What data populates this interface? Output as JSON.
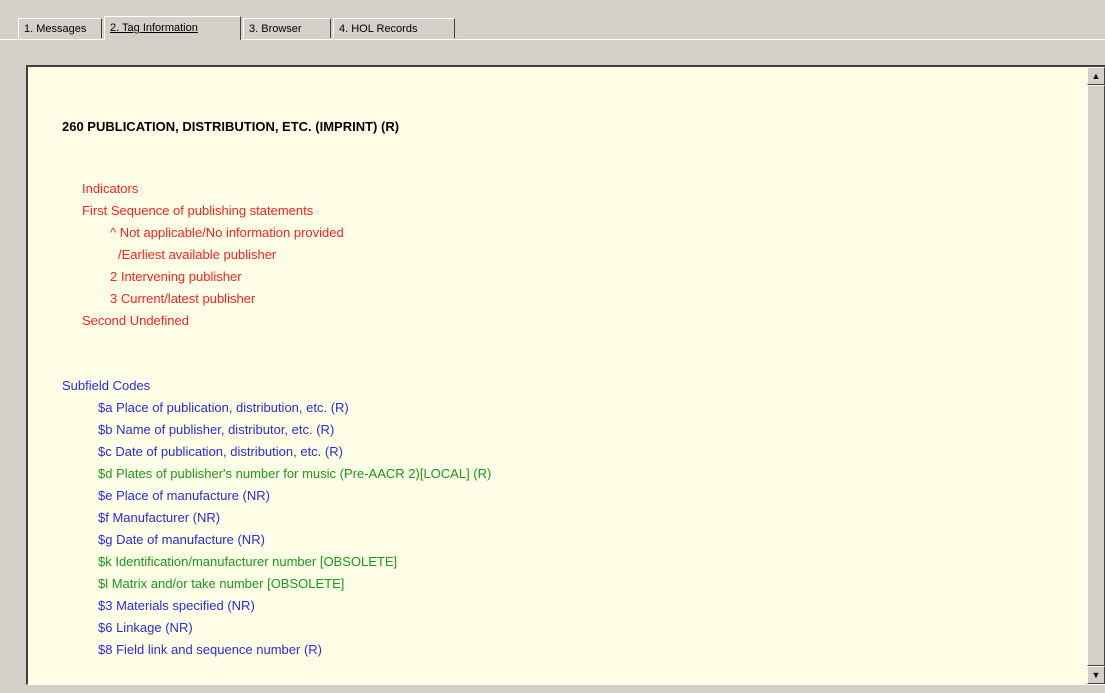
{
  "tabs": [
    {
      "label": "1. Messages"
    },
    {
      "label": "2. Tag Information"
    },
    {
      "label": "3. Browser"
    },
    {
      "label": "4. HOL Records"
    }
  ],
  "active_tab": "2. Tag Information",
  "field": {
    "title": "260  PUBLICATION, DISTRIBUTION, ETC. (IMPRINT)  (R)"
  },
  "indicators": {
    "heading": "Indicators",
    "first_label": "First  Sequence of publishing statements",
    "first_values": [
      "^   Not applicable/No information provided",
      "/Earliest available publisher",
      "2   Intervening publisher",
      "3   Current/latest publisher"
    ],
    "second_label": "Second  Undefined"
  },
  "subfields": {
    "heading": "Subfield Codes",
    "items": [
      {
        "text": "$a  Place of publication, distribution, etc.  (R)",
        "color": "#2a2ae0"
      },
      {
        "text": "$b  Name of publisher, distributor, etc.  (R)",
        "color": "#2a2ae0"
      },
      {
        "text": "$c  Date of publication, distribution, etc.  (R)",
        "color": "#2a2ae0"
      },
      {
        "text": "$d  Plates of publisher's number for music (Pre-AACR 2)[LOCAL]  (R)",
        "color": "#1a9a1a"
      },
      {
        "text": "$e  Place of manufacture  (NR)",
        "color": "#2a2ae0"
      },
      {
        "text": "$f  Manufacturer  (NR)",
        "color": "#2a2ae0"
      },
      {
        "text": "$g  Date of manufacture  (NR)",
        "color": "#2a2ae0"
      },
      {
        "text": "$k  Identification/manufacturer number  [OBSOLETE]",
        "color": "#1a9a1a"
      },
      {
        "text": "$l  Matrix and/or take number [OBSOLETE]",
        "color": "#1a9a1a"
      },
      {
        "text": "$3  Materials specified (NR)",
        "color": "#2a2ae0"
      },
      {
        "text": "$6  Linkage  (NR)",
        "color": "#2a2ae0"
      },
      {
        "text": "$8  Field link and sequence number  (R)",
        "color": "#2a2ae0"
      }
    ]
  },
  "colors": {
    "indicator_text": "#ff2020",
    "subfield_heading": "#2a2ae0",
    "panel_background": "#ffffe8"
  },
  "icons": {
    "scroll_up": "scroll-up-arrow-icon",
    "scroll_down": "scroll-down-arrow-icon"
  }
}
